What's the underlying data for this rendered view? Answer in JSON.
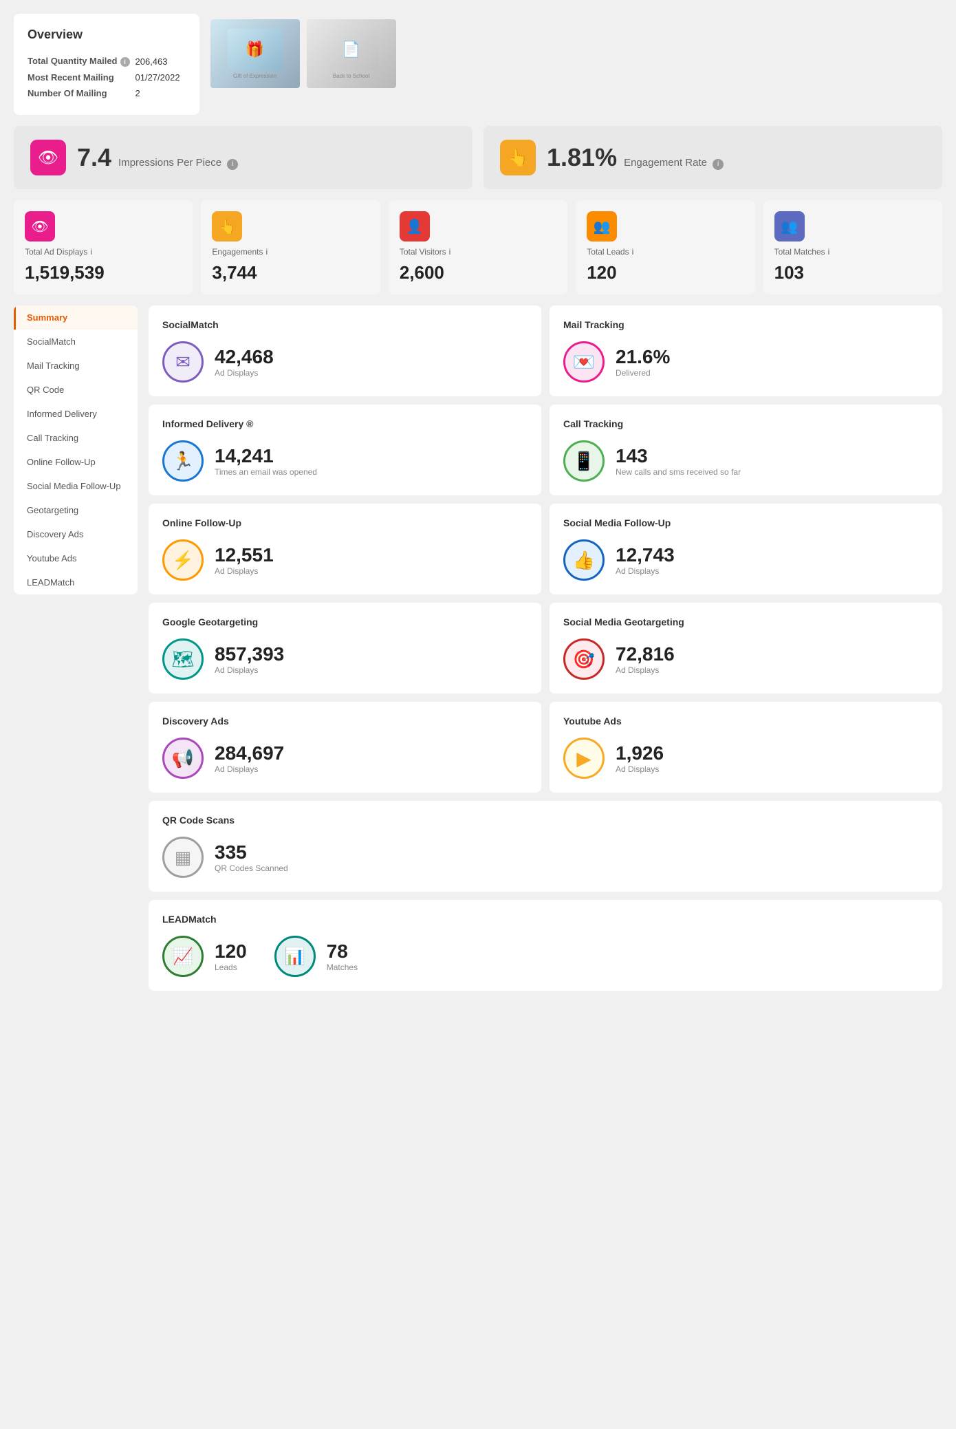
{
  "overview": {
    "title": "Overview",
    "fields": [
      {
        "label": "Total Quantity Mailed",
        "value": "206,463",
        "has_info": true
      },
      {
        "label": "Most Recent Mailing",
        "value": "01/27/2022",
        "has_info": false
      },
      {
        "label": "Number Of Mailing",
        "value": "2",
        "has_info": false
      }
    ]
  },
  "metric_bars": [
    {
      "icon": "👁",
      "icon_class": "icon-pink",
      "value": "7.4",
      "label": "Impressions Per Piece",
      "has_info": true
    },
    {
      "icon": "👆",
      "icon_class": "icon-gold",
      "value": "1.81%",
      "label": "Engagement Rate",
      "has_info": true
    }
  ],
  "stat_cards": [
    {
      "icon": "👁",
      "icon_bg": "#e91e8c",
      "label": "Total Ad Displays",
      "value": "1,519,539",
      "has_info": true
    },
    {
      "icon": "👆",
      "icon_bg": "#f5a623",
      "label": "Engagements",
      "value": "3,744",
      "has_info": true
    },
    {
      "icon": "👤",
      "icon_bg": "#e53935",
      "label": "Total Visitors",
      "value": "2,600",
      "has_info": true
    },
    {
      "icon": "👥",
      "icon_bg": "#fb8c00",
      "label": "Total Leads",
      "value": "120",
      "has_info": true
    },
    {
      "icon": "👥",
      "icon_bg": "#5c6bc0",
      "label": "Total Matches",
      "value": "103",
      "has_info": true
    }
  ],
  "sidebar": {
    "items": [
      {
        "label": "Summary",
        "active": true
      },
      {
        "label": "SocialMatch",
        "active": false
      },
      {
        "label": "Mail Tracking",
        "active": false
      },
      {
        "label": "QR Code",
        "active": false
      },
      {
        "label": "Informed Delivery",
        "active": false
      },
      {
        "label": "Call Tracking",
        "active": false
      },
      {
        "label": "Online Follow-Up",
        "active": false
      },
      {
        "label": "Social Media Follow-Up",
        "active": false
      },
      {
        "label": "Geotargeting",
        "active": false
      },
      {
        "label": "Discovery Ads",
        "active": false
      },
      {
        "label": "Youtube Ads",
        "active": false
      },
      {
        "label": "LEADMatch",
        "active": false
      }
    ]
  },
  "content_cards": {
    "row1": [
      {
        "title": "SocialMatch",
        "icon": "✉",
        "icon_class": "circle-purple",
        "value": "42,468",
        "label": "Ad Displays"
      },
      {
        "title": "Mail Tracking",
        "icon": "💌",
        "icon_class": "circle-pink",
        "value": "21.6%",
        "label": "Delivered"
      }
    ],
    "row2": [
      {
        "title": "Informed Delivery ®",
        "icon": "🏃",
        "icon_class": "circle-blue",
        "value": "14,241",
        "label": "Times an email was opened"
      },
      {
        "title": "Call Tracking",
        "icon": "📱",
        "icon_class": "circle-green-phone",
        "value": "143",
        "label": "New calls and sms received so far"
      }
    ],
    "row3": [
      {
        "title": "Online Follow-Up",
        "icon": "⚡",
        "icon_class": "circle-orange",
        "value": "12,551",
        "label": "Ad Displays"
      },
      {
        "title": "Social Media Follow-Up",
        "icon": "👍",
        "icon_class": "circle-dark-blue",
        "value": "12,743",
        "label": "Ad Displays"
      }
    ],
    "row4": [
      {
        "title": "Google Geotargeting",
        "icon": "🗺",
        "icon_class": "circle-teal",
        "value": "857,393",
        "label": "Ad Displays"
      },
      {
        "title": "Social Media Geotargeting",
        "icon": "🎯",
        "icon_class": "circle-red",
        "value": "72,816",
        "label": "Ad Displays"
      }
    ],
    "row5": [
      {
        "title": "Discovery Ads",
        "icon": "📢",
        "icon_class": "circle-magenta",
        "value": "284,697",
        "label": "Ad Displays"
      },
      {
        "title": "Youtube Ads",
        "icon": "▶",
        "icon_class": "circle-yellow",
        "value": "1,926",
        "label": "Ad Displays"
      }
    ],
    "qr": {
      "title": "QR Code Scans",
      "icon": "▦",
      "icon_class": "circle-gray",
      "value": "335",
      "label": "QR Codes Scanned"
    },
    "leadmatch": {
      "title": "LEADMatch",
      "items": [
        {
          "icon": "📈",
          "icon_class": "circle-green",
          "value": "120",
          "label": "Leads"
        },
        {
          "icon": "📊",
          "icon_class": "circle-green2",
          "value": "78",
          "label": "Matches"
        }
      ]
    }
  }
}
